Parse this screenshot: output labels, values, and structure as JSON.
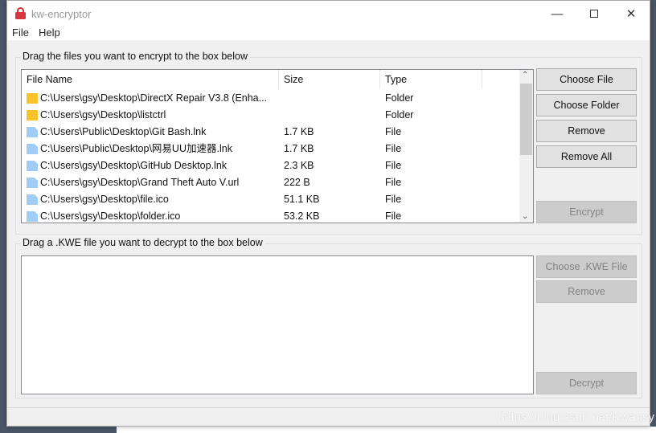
{
  "window": {
    "title": "kw-encryptor",
    "icon": "lock-icon",
    "controls": [
      "minimize",
      "maximize",
      "close"
    ]
  },
  "menu": [
    "File",
    "Help"
  ],
  "encrypt_group": {
    "label": "Drag the files you want to encrypt to the box below",
    "columns": [
      "File Name",
      "Size",
      "Type"
    ],
    "rows": [
      {
        "icon": "folder",
        "name": "C:\\Users\\gsy\\Desktop\\DirectX Repair V3.8 (Enha...",
        "size": "",
        "type": "Folder"
      },
      {
        "icon": "folder",
        "name": "C:\\Users\\gsy\\Desktop\\listctrl",
        "size": "",
        "type": "Folder"
      },
      {
        "icon": "file",
        "name": "C:\\Users\\Public\\Desktop\\Git Bash.lnk",
        "size": "1.7 KB",
        "type": "File"
      },
      {
        "icon": "file",
        "name": "C:\\Users\\Public\\Desktop\\网易UU加速器.lnk",
        "size": "1.7 KB",
        "type": "File"
      },
      {
        "icon": "file",
        "name": "C:\\Users\\gsy\\Desktop\\GitHub Desktop.lnk",
        "size": "2.3 KB",
        "type": "File"
      },
      {
        "icon": "file",
        "name": "C:\\Users\\gsy\\Desktop\\Grand Theft Auto V.url",
        "size": "222 B",
        "type": "File"
      },
      {
        "icon": "file",
        "name": "C:\\Users\\gsy\\Desktop\\file.ico",
        "size": "51.1 KB",
        "type": "File"
      },
      {
        "icon": "file",
        "name": "C:\\Users\\gsy\\Desktop\\folder.ico",
        "size": "53.2 KB",
        "type": "File"
      }
    ],
    "buttons": {
      "choose_file": "Choose File",
      "choose_folder": "Choose Folder",
      "remove": "Remove",
      "remove_all": "Remove All",
      "encrypt": "Encrypt"
    }
  },
  "decrypt_group": {
    "label": "Drag a .KWE file you want to decrypt to the box below",
    "buttons": {
      "choose_kwe": "Choose .KWE File",
      "remove": "Remove",
      "decrypt": "Decrypt"
    }
  },
  "watermark": "https://blog.csdn.net/Kwansy"
}
